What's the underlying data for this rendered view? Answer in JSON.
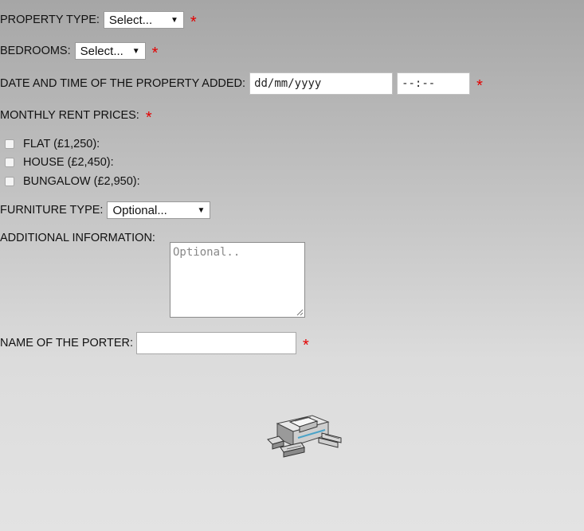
{
  "form": {
    "property_type": {
      "label": "PROPERTY TYPE:",
      "selected": "Select...",
      "required": "*"
    },
    "bedrooms": {
      "label": "BEDROOMS:",
      "selected": "Select...",
      "required": "*"
    },
    "date_added": {
      "label": "DATE AND TIME OF THE PROPERTY ADDED:",
      "date_placeholder": "dd/mm/yyyy",
      "time_placeholder": "--:--",
      "required": "*"
    },
    "rent_prices": {
      "label": "MONTHLY RENT PRICES:",
      "required": "*",
      "options": [
        {
          "label": "FLAT (£1,250):",
          "checked": false
        },
        {
          "label": "HOUSE (£2,450):",
          "checked": false
        },
        {
          "label": "BUNGALOW (£2,950):",
          "checked": false
        }
      ]
    },
    "furniture_type": {
      "label": "FURNITURE TYPE:",
      "selected": "Optional..."
    },
    "additional_info": {
      "label": "ADDITIONAL INFORMATION:",
      "placeholder": "Optional.."
    },
    "porter_name": {
      "label": "NAME OF THE PORTER:",
      "value": "",
      "required": "*"
    }
  },
  "icons": {
    "bottom_graphic": "delivery-robot-icon"
  },
  "colors": {
    "required_marker": "#e30000"
  }
}
